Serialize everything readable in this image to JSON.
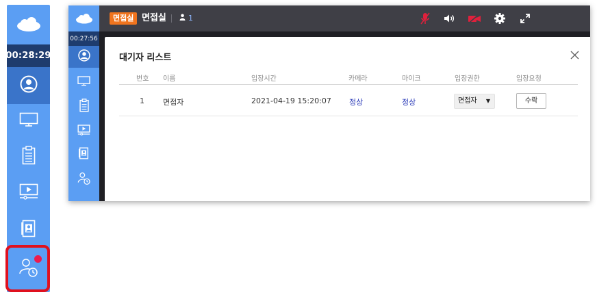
{
  "left_sidebar": {
    "timer": "00:28:29",
    "items": [
      {
        "icon": "user-circle-icon"
      },
      {
        "icon": "monitor-icon"
      },
      {
        "icon": "clipboard-icon"
      },
      {
        "icon": "video-player-icon"
      },
      {
        "icon": "contact-card-icon"
      },
      {
        "icon": "user-clock-icon",
        "notification": true
      }
    ],
    "highlight_color": "#e0101e",
    "bg_color": "#5b9ef3",
    "timer_bg": "#1e3c6e"
  },
  "screenshot": {
    "topbar": {
      "room_badge": "면접실",
      "room_name": "면접실",
      "user_count": "1",
      "badge_color": "#f0741e",
      "icons": [
        "mic-muted-icon",
        "speaker-icon",
        "camera-off-icon",
        "gear-icon",
        "fullscreen-icon"
      ]
    },
    "mini_sidebar": {
      "timer": "00:27:56"
    },
    "modal": {
      "title": "대기자 리스트",
      "columns": [
        "번호",
        "이름",
        "입장시간",
        "카메라",
        "마이크",
        "입장권한",
        "입장요청"
      ],
      "rows": [
        {
          "no": "1",
          "name": "면접자",
          "time": "2021-04-19 15:20:07",
          "camera": "정상",
          "mic": "정상",
          "permission": "면접자",
          "action": "수락"
        }
      ]
    }
  }
}
